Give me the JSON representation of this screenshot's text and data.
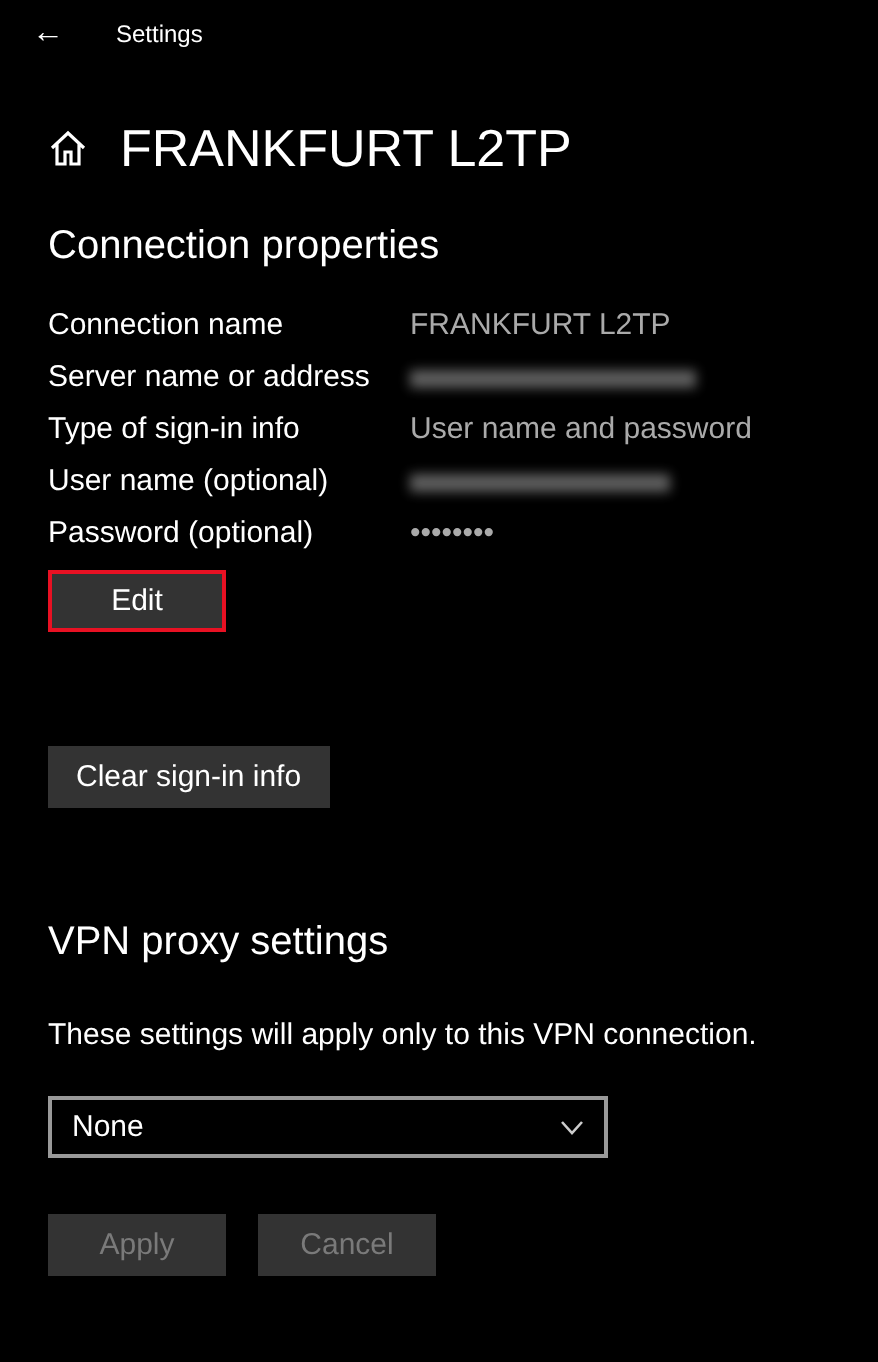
{
  "title_bar": {
    "back": "←",
    "title": "Settings"
  },
  "heading": "FRANKFURT L2TP",
  "connection_properties": {
    "title": "Connection properties",
    "rows": [
      {
        "label": "Connection name",
        "kind": "text",
        "value": "FRANKFURT L2TP"
      },
      {
        "label": "Server name or address",
        "kind": "redacted"
      },
      {
        "label": "Type of sign-in info",
        "kind": "text",
        "value": "User name and password"
      },
      {
        "label": "User name (optional)",
        "kind": "redacted"
      },
      {
        "label": "Password (optional)",
        "kind": "text",
        "value": "••••••••"
      }
    ],
    "edit_button": {
      "label": "Edit",
      "highlighted": true
    },
    "clear_button": {
      "label": "Clear sign-in info"
    }
  },
  "vpn_proxy": {
    "title": "VPN proxy settings",
    "note": "These settings will apply only to this VPN connection.",
    "dropdown": {
      "value": "None"
    },
    "buttons": [
      {
        "label": "Apply",
        "disabled": true
      },
      {
        "label": "Cancel",
        "disabled": true
      }
    ]
  }
}
